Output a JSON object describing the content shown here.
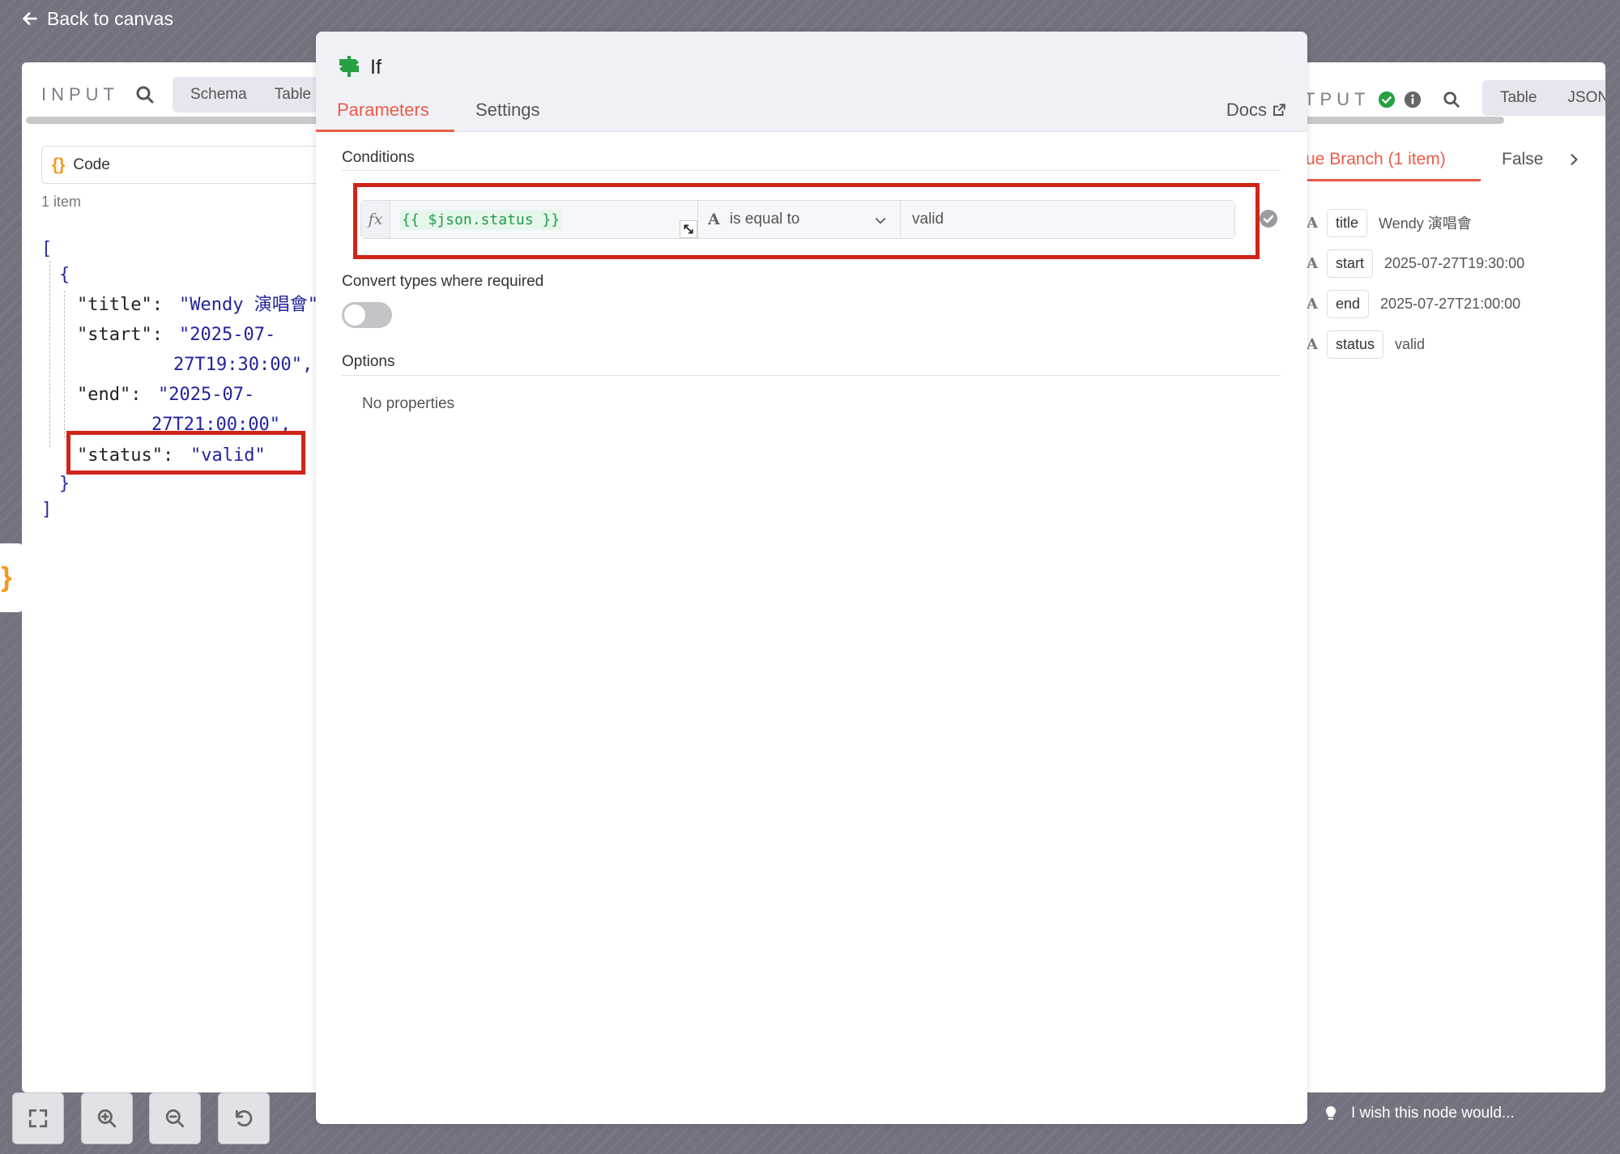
{
  "header": {
    "back_label": "Back to canvas"
  },
  "input_panel": {
    "title": "INPUT",
    "tabs": [
      "Schema",
      "Table"
    ],
    "node_select": "Code",
    "item_count": "1 item",
    "json_lines": [
      "[",
      "{",
      "\"title\":",
      "\"Wendy 演唱會\"",
      "\"start\":",
      "\"2025-07-",
      "27T19:30:00\",",
      "\"end\":",
      "\"2025-07-",
      "27T21:00:00\",",
      "\"status\":",
      "\"valid\"",
      "}",
      "]"
    ]
  },
  "modal": {
    "node_title": "If",
    "tabs": {
      "parameters": "Parameters",
      "settings": "Settings"
    },
    "docs_label": "Docs",
    "conditions_label": "Conditions",
    "condition": {
      "fx": "fx",
      "left_value": "{{ $json.status }}",
      "type_icon": "A",
      "operator": "is equal to",
      "right_value": "valid"
    },
    "convert_types_label": "Convert types where required",
    "convert_types_enabled": false,
    "options_label": "Options",
    "no_properties": "No properties"
  },
  "output_panel": {
    "title": "TPUT",
    "tabs": [
      "Table",
      "JSON"
    ],
    "branch_true": "ue Branch (1 item)",
    "branch_false": "False",
    "rows": [
      {
        "type": "A",
        "key": "title",
        "value": "Wendy 演唱會"
      },
      {
        "type": "A",
        "key": "start",
        "value": "2025-07-27T19:30:00"
      },
      {
        "type": "A",
        "key": "end",
        "value": "2025-07-27T21:00:00"
      },
      {
        "type": "A",
        "key": "status",
        "value": "valid"
      }
    ]
  },
  "side_tab": {
    "glyph": "}"
  },
  "feedback": {
    "label": "I wish this node would..."
  },
  "colors": {
    "accent": "#ea5b47",
    "success": "#26a043",
    "highlight": "#d02418",
    "json_value": "#23239c"
  }
}
